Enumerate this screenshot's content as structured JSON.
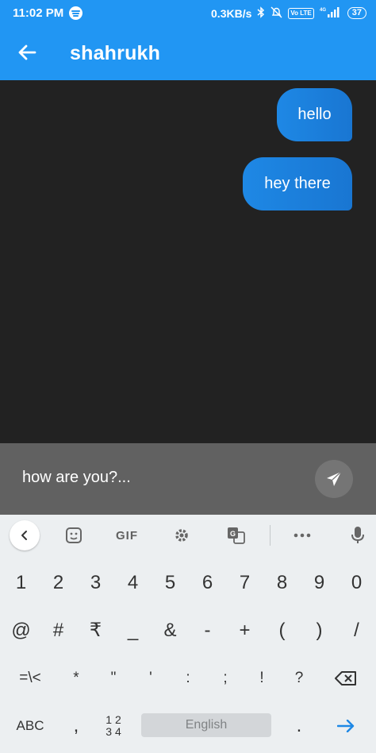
{
  "status_bar": {
    "time": "11:02 PM",
    "speed": "0.3KB/s",
    "network": "4G",
    "volte": "Vo LTE",
    "battery": "37"
  },
  "app_bar": {
    "title": "shahrukh"
  },
  "messages": [
    {
      "text": "hello",
      "direction": "outgoing"
    },
    {
      "text": "hey there",
      "direction": "outgoing"
    }
  ],
  "composer": {
    "value": "how are you?..."
  },
  "keyboard": {
    "toolbar": {
      "gif_label": "GIF"
    },
    "row1": [
      "1",
      "2",
      "3",
      "4",
      "5",
      "6",
      "7",
      "8",
      "9",
      "0"
    ],
    "row2": [
      "@",
      "#",
      "₹",
      "_",
      "&",
      "-",
      "+",
      "(",
      ")",
      "/"
    ],
    "row3": [
      "=\\<",
      "*",
      "\"",
      "'",
      ":",
      ";",
      "!",
      "?"
    ],
    "row4": {
      "abc_label": "ABC",
      "comma": ",",
      "num_top": "1 2",
      "num_bottom": "3 4",
      "space_label": "English",
      "period": "."
    }
  },
  "colors": {
    "accent": "#2196F3",
    "bubble": "#1E88E5",
    "chat_bg": "#222222",
    "composer_bg": "#616161",
    "keyboard_bg": "#ECEFF1"
  }
}
